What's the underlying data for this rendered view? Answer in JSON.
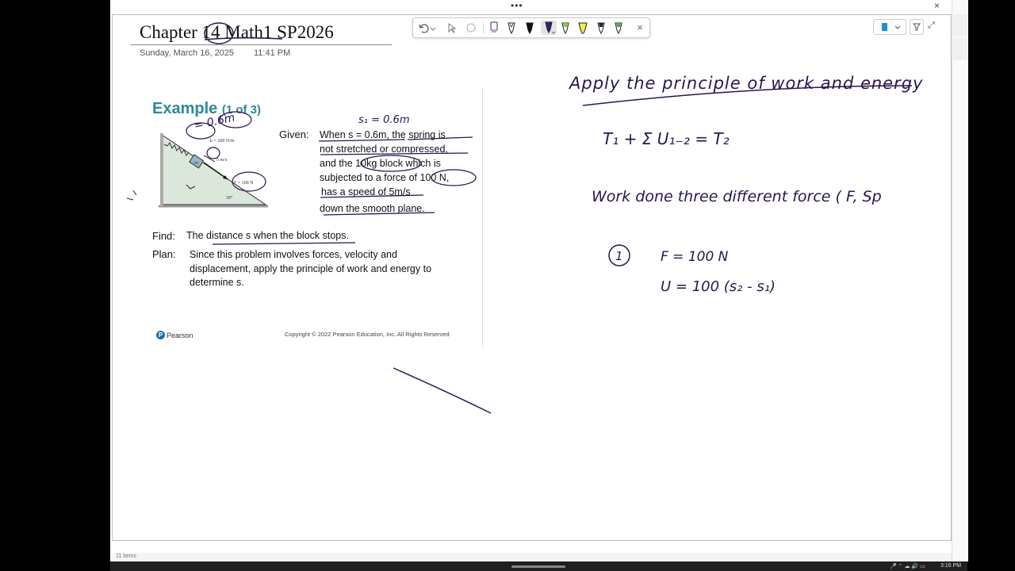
{
  "window": {
    "close_glyph": "×",
    "more_glyph": "•••",
    "status": "11 items"
  },
  "toolbar": {
    "tools": [
      "undo-icon",
      "redo-dropdown-icon",
      "select-icon",
      "lasso-icon",
      "eraser-pen-icon",
      "pen-black-icon",
      "pen-black-2-icon",
      "pen-purple-icon",
      "pen-green-icon",
      "highlighter-yellow-icon",
      "pen-dark-icon",
      "pen-green-2-icon",
      "close-icon"
    ],
    "close_glyph": "×"
  },
  "page": {
    "title": "Chapter 14 Math1 SP2026",
    "date": "Sunday, March 16, 2025",
    "time": "11:41 PM"
  },
  "slide": {
    "example": "Example",
    "example_sub": "(1 of 3)",
    "given_label": "Given:",
    "given_lines": [
      "When      s = 0.6m, the spring is",
      "not stretched or compressed,",
      "and the   10kg  block which is",
      "subjected to a  force of 100 N,",
      "has a speed of 5m/s",
      "down the smooth plane."
    ],
    "find_label": "Find:",
    "find_text": "The distance s when the block stops.",
    "plan_label": "Plan:",
    "plan_lines": [
      "Since this problem involves forces, velocity and",
      "displacement, apply the principle of work and energy to",
      "determine s."
    ],
    "figure": {
      "spring_label": "k = 200 N/m",
      "speed_label": "5 m/s",
      "force_label": "F = 100 N",
      "angle_label": "30°",
      "block_label": "m"
    },
    "publisher": "Pearson",
    "copyright": "Copyright © 2022 Pearson Education, Inc. All Rights Reserved"
  },
  "notes": {
    "heading": "Apply the principle of work and energy",
    "equation": "T₁ + Σ U₁₋₂ = T₂",
    "line2": "Work done three different force ( F, Sp",
    "item_number": "1",
    "item_f": "F = 100 N",
    "item_u": "U = 100 (s₂ - s₁)",
    "slide_note": "s₁ = 0.6m",
    "fig_note": "= 0.6m"
  },
  "taskbar": {
    "time": "3:16 PM"
  },
  "colors": {
    "ink": "#2a1550",
    "accent": "#2b8a99"
  }
}
